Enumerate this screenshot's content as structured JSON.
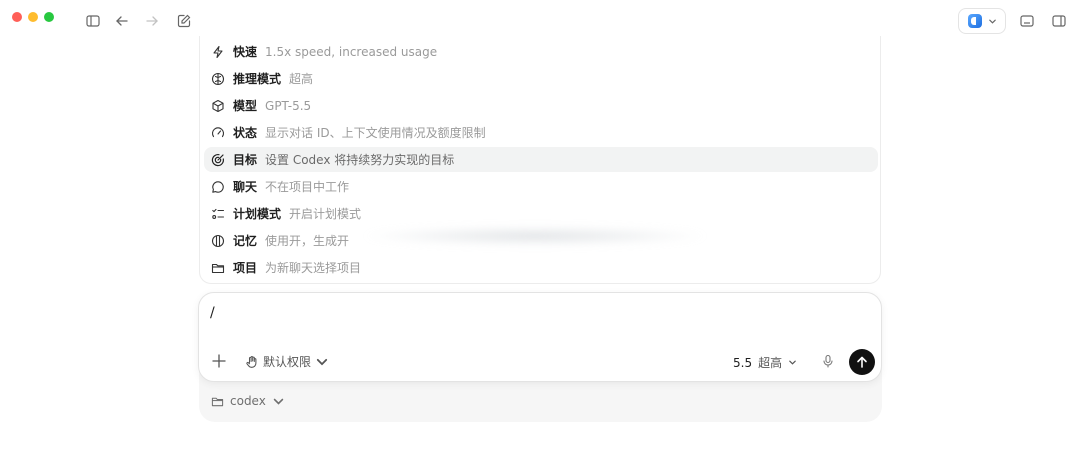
{
  "menu": {
    "items": [
      {
        "label": "快速",
        "desc": "1.5x speed, increased usage",
        "icon": "lightning-icon"
      },
      {
        "label": "推理模式",
        "desc": "超高",
        "icon": "brain-icon"
      },
      {
        "label": "模型",
        "desc": "GPT-5.5",
        "icon": "cube-icon"
      },
      {
        "label": "状态",
        "desc": "显示对话 ID、上下文使用情况及额度限制",
        "icon": "gauge-icon"
      },
      {
        "label": "目标",
        "desc": "设置 Codex 将持续努力实现的目标",
        "icon": "target-icon"
      },
      {
        "label": "聊天",
        "desc": "不在项目中工作",
        "icon": "chat-bubble-icon"
      },
      {
        "label": "计划模式",
        "desc": "开启计划模式",
        "icon": "checklist-icon"
      },
      {
        "label": "记忆",
        "desc": "使用开，生成开",
        "icon": "memory-icon"
      },
      {
        "label": "项目",
        "desc": "为新聊天选择项目",
        "icon": "folder-icon"
      }
    ],
    "active_index": 4
  },
  "composer": {
    "input_value": "/",
    "permission_label": "默认权限",
    "model_version": "5.5",
    "reasoning_level": "超高"
  },
  "footer": {
    "project_name": "codex"
  },
  "colors": {
    "send_button": "#111111",
    "active_row": "#f2f3f3",
    "muted_text": "#9a9a9a"
  }
}
